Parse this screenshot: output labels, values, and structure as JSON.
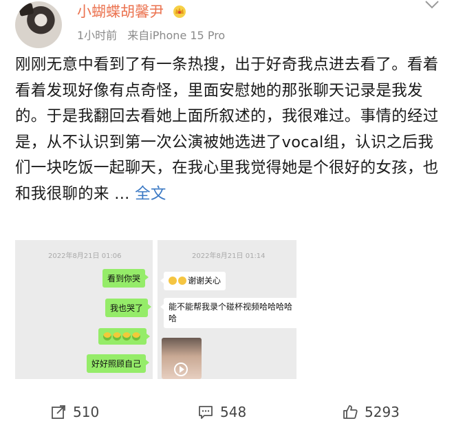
{
  "user": {
    "name": "小蝴蝶胡馨尹",
    "time": "1小时前",
    "source": "来自iPhone 15 Pro"
  },
  "post": {
    "text": "刚刚无意中看到了有一条热搜，出于好奇我点进去看了。看着看着发现好像有点奇怪，里面安慰她的那张聊天记录是我发的。于是我翻回去看她上面所叙述的，我很难过。事情的经过是，从不认识到第一次公演被她选进了vocal组，认识之后我们一块吃饭一起聊天，在我心里我觉得她是个很好的女孩，也和我很聊的来",
    "ellipsis": " ... ",
    "more_link": "全文"
  },
  "images": [
    {
      "timestamp": "2022年8月21日 01:06",
      "messages": [
        "看到你哭",
        "我也哭了",
        "",
        "好好照顾自己"
      ]
    },
    {
      "timestamp": "2022年8月21日 01:14",
      "messages": [
        "谢谢关心",
        "能不能帮我录个碰杯视频哈哈哈哈哈"
      ]
    }
  ],
  "actions": {
    "repost": "510",
    "comment": "548",
    "like": "5293"
  },
  "colors": {
    "username": "#eb7350",
    "link": "#3b79c4",
    "wechat_green": "#95ec69"
  },
  "icons": [
    "crown-icon",
    "chevron-down-icon",
    "repost-icon",
    "comment-icon",
    "like-icon",
    "play-icon"
  ]
}
